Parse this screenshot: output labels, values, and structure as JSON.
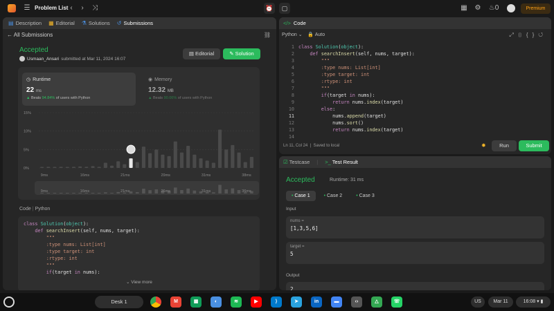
{
  "topbar": {
    "title": "Problem List",
    "premium": "Premium",
    "streak": "0"
  },
  "left": {
    "tabs": [
      {
        "icon": "▤",
        "label": "Description"
      },
      {
        "icon": "▦",
        "label": "Editorial"
      },
      {
        "icon": "⚗",
        "label": "Solutions"
      },
      {
        "icon": "↺",
        "label": "Submissions"
      }
    ],
    "back_label": "All Submissions",
    "status": "Accepted",
    "user": "Usmaan_Ansari",
    "submitted": "submitted at Mar 11, 2024 16:07",
    "editorial_btn": "Editorial",
    "solution_btn": "Solution",
    "runtime": {
      "label": "Runtime",
      "value": "22",
      "unit": "ms",
      "beats_prefix": "Beats",
      "beats": "94.84%",
      "beats_suffix": "of users with Python"
    },
    "memory": {
      "label": "Memory",
      "value": "12.32",
      "unit": "MB",
      "beats_prefix": "Beats",
      "beats": "90.06%",
      "beats_suffix": "of users with Python"
    },
    "code_lang_1": "Code",
    "code_lang_2": "Python",
    "view_more": "View more",
    "code_lines": [
      "class Solution(object):",
      "    def searchInsert(self, nums, target):",
      "        \"\"\"",
      "        :type nums: List[int]",
      "        :type target: int",
      "        :rtype: int",
      "        \"\"\"",
      "        if(target in nums):"
    ]
  },
  "chart_data": {
    "type": "bar",
    "x_ticks": [
      "9ms",
      "16ms",
      "21ms",
      "29ms",
      "31ms",
      "38ms"
    ],
    "mini_ticks": [
      "9ms",
      "16ms",
      "21ms",
      "26ms",
      "31ms",
      "36ms"
    ],
    "y_ticks": [
      "15%",
      "10%",
      "5%",
      "0%"
    ],
    "ylim": [
      0,
      15
    ],
    "values": [
      0.2,
      0.3,
      0.2,
      0.3,
      0.2,
      0.3,
      0.4,
      0.3,
      0.5,
      0.3,
      1.4,
      0.6,
      1.8,
      1.0,
      2.6,
      1.6,
      5.8,
      4.0,
      5.0,
      3.6,
      3.2,
      7.2,
      4.2,
      6.0,
      3.6,
      2.6,
      2.0,
      1.4,
      10.4,
      5.0,
      6.2,
      4.2,
      1.6,
      3.0
    ],
    "highlight_index": 14
  },
  "code": {
    "title": "Code",
    "language": "Python",
    "mode": "Auto",
    "status_pos": "Ln 11, Col 24",
    "status_saved": "Saved to local",
    "run": "Run",
    "submit": "Submit",
    "lines": [
      "class Solution(object):",
      "    def searchInsert(self, nums, target):",
      "        \"\"\"",
      "        :type nums: List[int]",
      "        :type target: int",
      "        :rtype: int",
      "        \"\"\"",
      "        if(target in nums):",
      "            return nums.index(target)",
      "        else:",
      "            nums.append(target)",
      "            nums.sort()",
      "            return nums.index(target)",
      ""
    ]
  },
  "test": {
    "tab_testcase": "Testcase",
    "tab_result": "Test Result",
    "status": "Accepted",
    "runtime": "Runtime: 31 ms",
    "cases": [
      "Case 1",
      "Case 2",
      "Case 3"
    ],
    "input_label": "Input",
    "var1": "nums =",
    "val1": "[1,3,5,6]",
    "var2": "target =",
    "val2": "5",
    "output_label": "Output",
    "output_val": "2"
  },
  "taskbar": {
    "desk": "Desk 1",
    "lang": "US",
    "date": "Mar 11",
    "time": "16:08",
    "apps": [
      {
        "name": "chrome",
        "letter": "",
        "color": "#4285f4"
      },
      {
        "name": "gmail",
        "letter": "M",
        "color": "#ea4335"
      },
      {
        "name": "sheets",
        "letter": "▦",
        "color": "#0f9d58"
      },
      {
        "name": "maps",
        "letter": "◐",
        "color": "#4a90e2"
      },
      {
        "name": "spotify",
        "letter": "≋",
        "color": "#1db954"
      },
      {
        "name": "youtube",
        "letter": "▶",
        "color": "#ff0000"
      },
      {
        "name": "vscode",
        "letter": "⟩",
        "color": "#007acc"
      },
      {
        "name": "telegram",
        "letter": "➤",
        "color": "#2aa3df"
      },
      {
        "name": "linkedin",
        "letter": "in",
        "color": "#0a66c2"
      },
      {
        "name": "files",
        "letter": "▬",
        "color": "#4285f4"
      },
      {
        "name": "terminal",
        "letter": "‹›",
        "color": "#555555"
      },
      {
        "name": "drive",
        "letter": "△",
        "color": "#34a853"
      },
      {
        "name": "whatsapp",
        "letter": "☏",
        "color": "#25d366"
      }
    ]
  }
}
